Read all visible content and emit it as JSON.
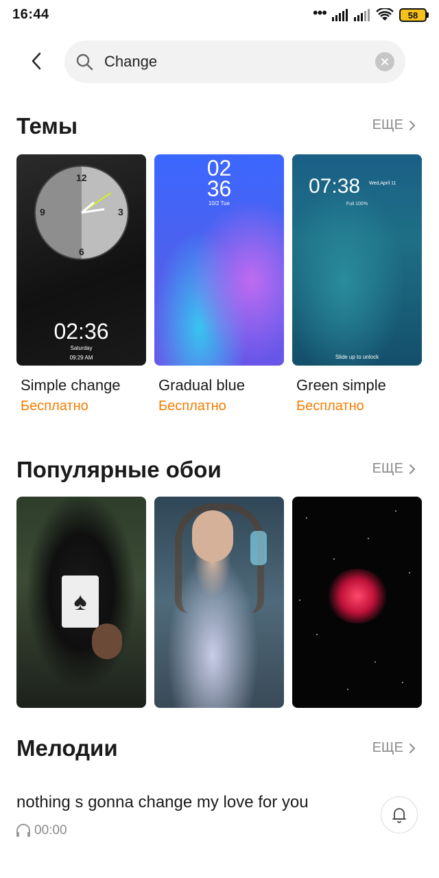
{
  "status_bar": {
    "time": "16:44",
    "battery": "58",
    "dots": "•••"
  },
  "search": {
    "value": "Change"
  },
  "themes": {
    "title": "Темы",
    "more_label": "ЕЩЕ",
    "items": [
      {
        "name": "Simple change",
        "price": "Бесплатно",
        "preview": {
          "time": "02:36",
          "day": "Saturday",
          "sub": "09:29 AM",
          "clock_numbers": [
            "12",
            "3",
            "6",
            "9"
          ]
        }
      },
      {
        "name": "Gradual blue",
        "price": "Бесплатно",
        "preview": {
          "hour": "02",
          "minute": "36",
          "date": "10/2 Tue"
        }
      },
      {
        "name": "Green simple",
        "price": "Бесплатно",
        "preview": {
          "time": "07:38",
          "date": "Wed,April 11",
          "battery": "Full 100%",
          "unlock": "Slide up to unlock"
        }
      }
    ]
  },
  "wallpapers": {
    "title": "Популярные обои",
    "more_label": "ЕЩЕ",
    "items": [
      {
        "subject": "hooded figure holding ace of spades card"
      },
      {
        "subject": "woman with long hair holding a glass"
      },
      {
        "subject": "red rose nebula in starfield"
      }
    ]
  },
  "melodies": {
    "title": "Мелодии",
    "more_label": "ЕЩЕ",
    "items": [
      {
        "title": "nothing s gonna change my love for you",
        "duration": "00:00"
      }
    ]
  },
  "colors": {
    "accent_price": "#f57c00",
    "underline": "#e53935"
  }
}
